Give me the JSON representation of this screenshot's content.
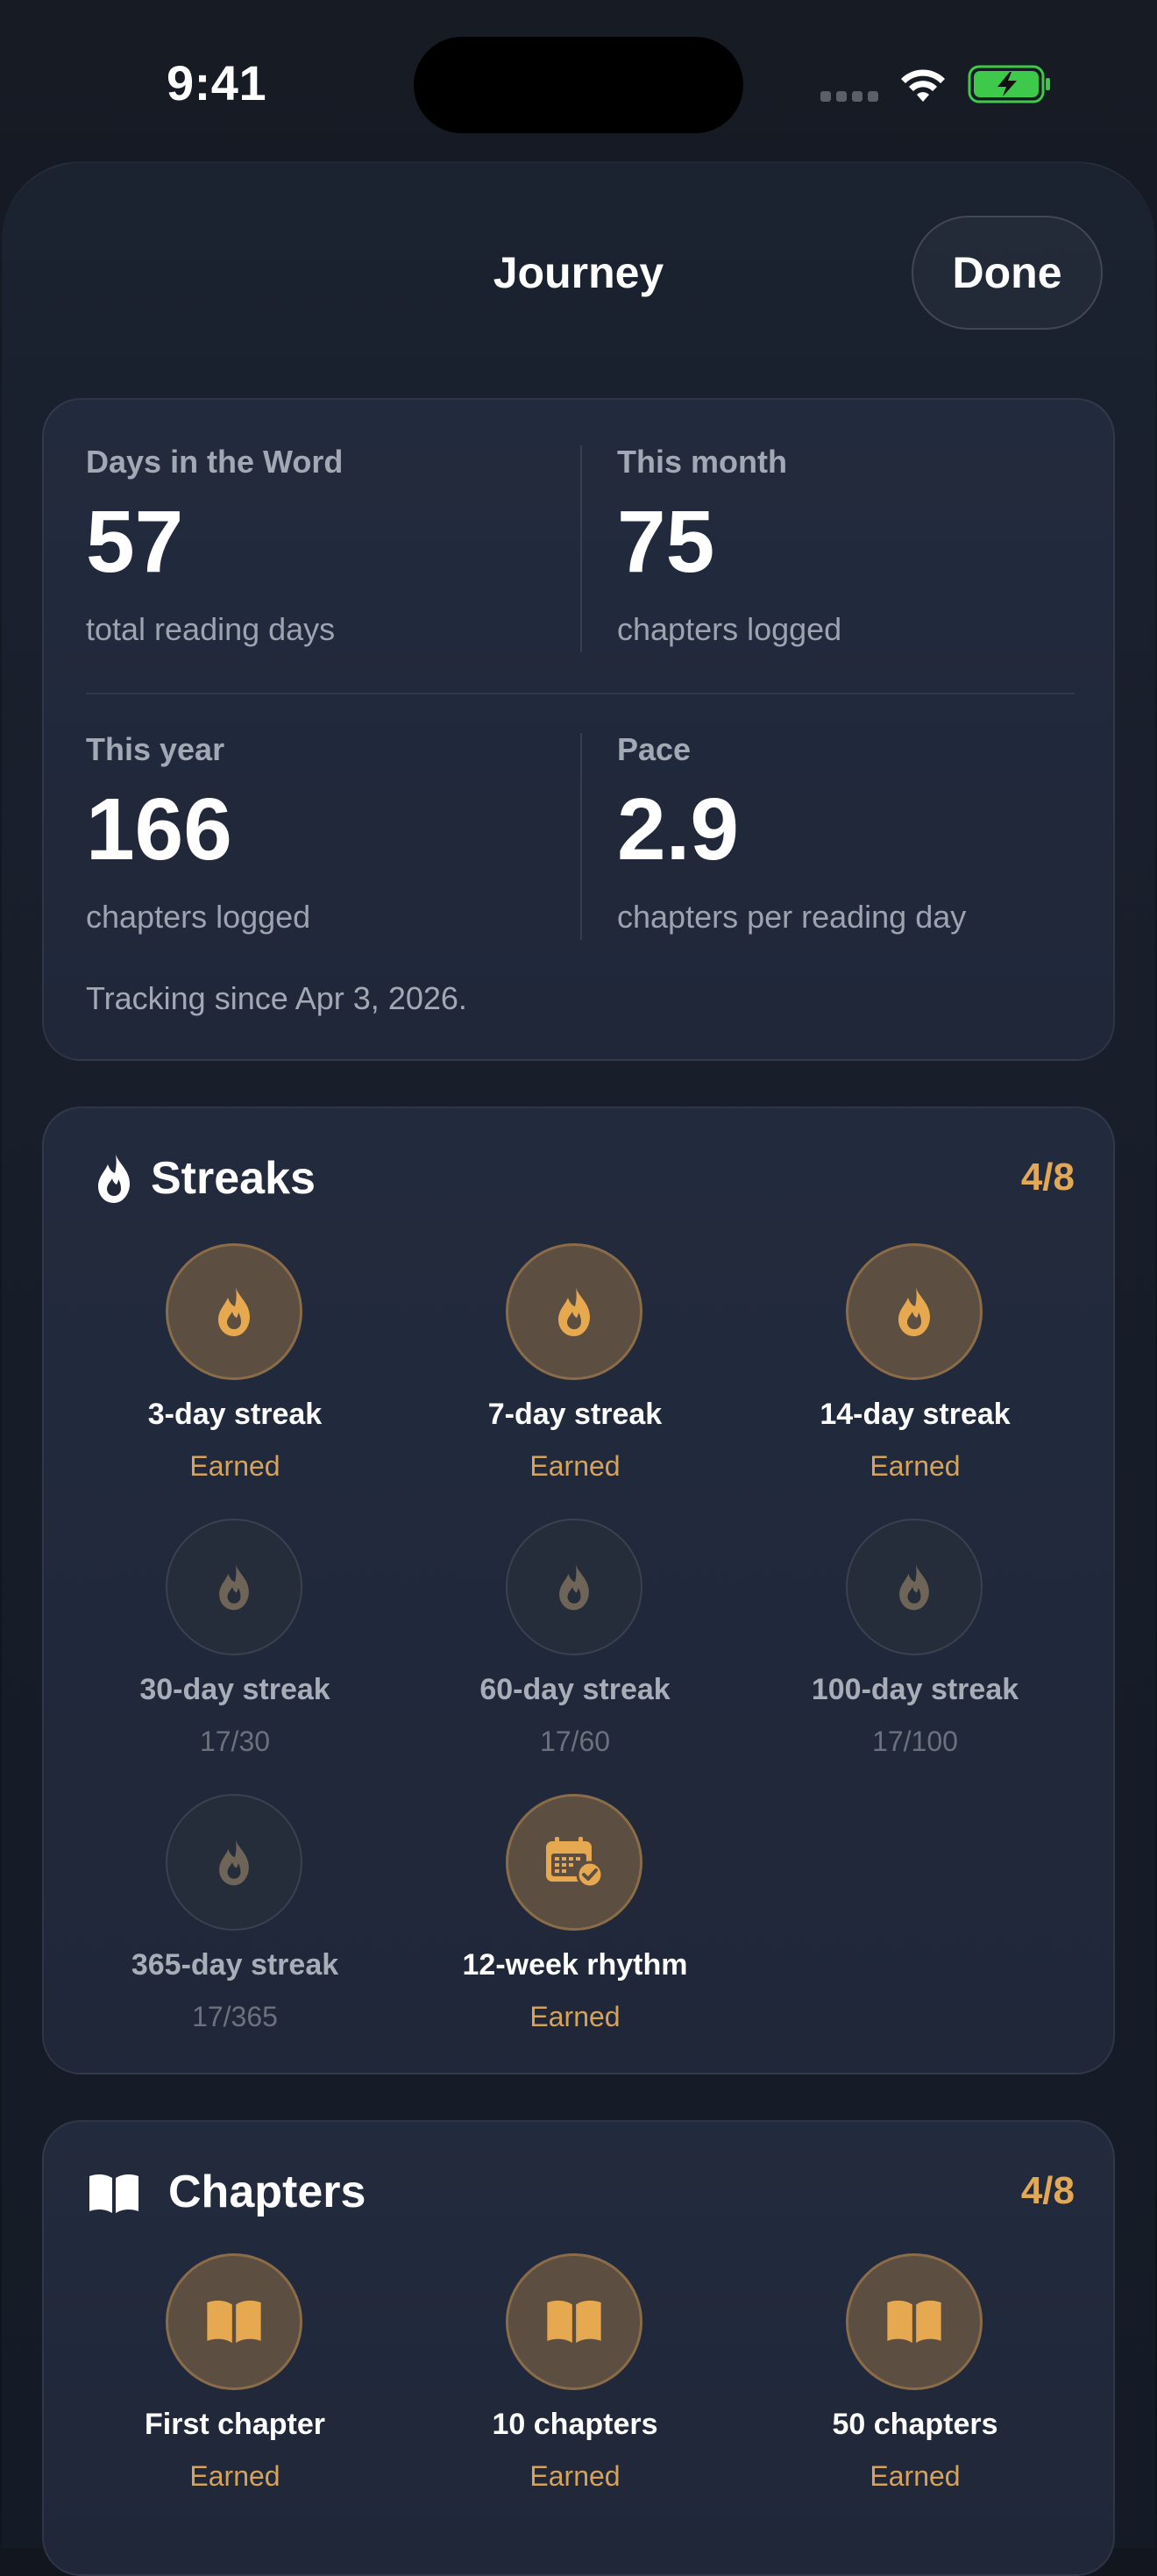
{
  "status_bar": {
    "time": "9:41"
  },
  "sheet": {
    "title": "Journey",
    "done_label": "Done"
  },
  "stats": {
    "days": {
      "label": "Days in the Word",
      "value": "57",
      "sub": "total reading days"
    },
    "month": {
      "label": "This month",
      "value": "75",
      "sub": "chapters logged"
    },
    "year": {
      "label": "This year",
      "value": "166",
      "sub": "chapters logged"
    },
    "pace": {
      "label": "Pace",
      "value": "2.9",
      "sub": "chapters per reading day"
    },
    "tracking_note": "Tracking since Apr 3, 2026."
  },
  "streaks": {
    "title": "Streaks",
    "count": "4/8",
    "icon": "flame-icon",
    "badges": [
      {
        "name": "3-day streak",
        "status": "Earned",
        "earned": true,
        "icon": "flame-icon"
      },
      {
        "name": "7-day streak",
        "status": "Earned",
        "earned": true,
        "icon": "flame-icon"
      },
      {
        "name": "14-day streak",
        "status": "Earned",
        "earned": true,
        "icon": "flame-icon"
      },
      {
        "name": "30-day streak",
        "status": "17/30",
        "earned": false,
        "icon": "flame-icon"
      },
      {
        "name": "60-day streak",
        "status": "17/60",
        "earned": false,
        "icon": "flame-icon"
      },
      {
        "name": "100-day streak",
        "status": "17/100",
        "earned": false,
        "icon": "flame-icon"
      },
      {
        "name": "365-day streak",
        "status": "17/365",
        "earned": false,
        "icon": "flame-icon"
      },
      {
        "name": "12-week rhythm",
        "status": "Earned",
        "earned": true,
        "icon": "calendar-check-icon"
      }
    ]
  },
  "chapters": {
    "title": "Chapters",
    "count": "4/8",
    "icon": "open-book-icon",
    "badges": [
      {
        "name": "First chapter",
        "status": "Earned",
        "earned": true,
        "icon": "open-book-icon"
      },
      {
        "name": "10 chapters",
        "status": "Earned",
        "earned": true,
        "icon": "open-book-icon"
      },
      {
        "name": "50 chapters",
        "status": "Earned",
        "earned": true,
        "icon": "open-book-icon"
      }
    ]
  },
  "colors": {
    "accent": "#e2a855",
    "earned_badge_bg": "#5c4e40",
    "locked_badge_bg": "#262d3a",
    "card_bg": "#222b3d",
    "battery_green": "#3ec94a"
  }
}
